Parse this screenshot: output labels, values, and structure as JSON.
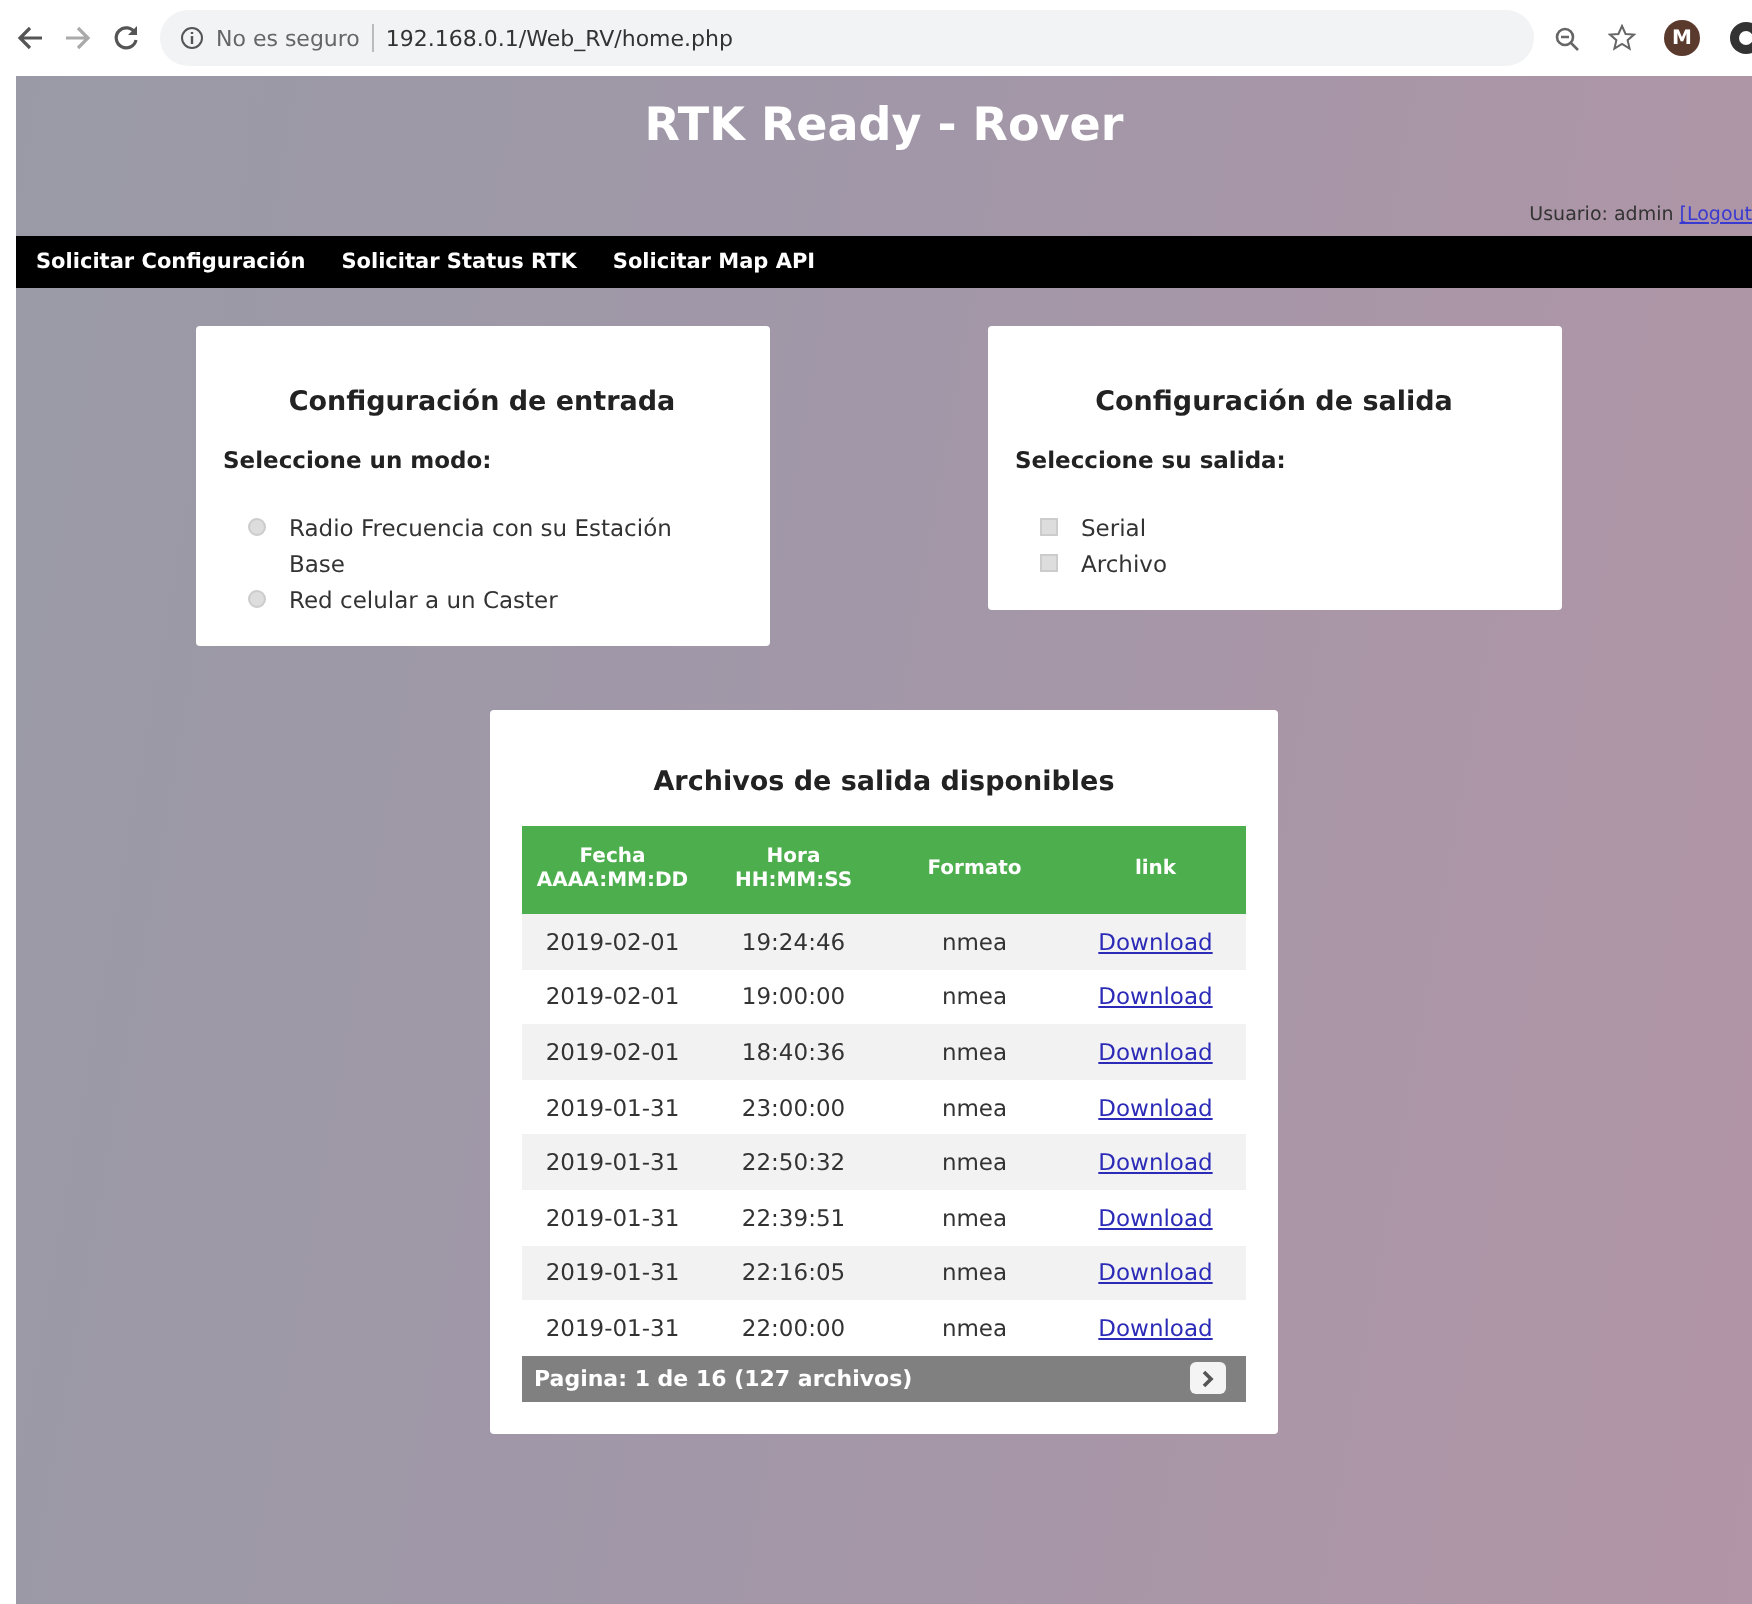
{
  "browser": {
    "security": "No es seguro",
    "url": "192.168.0.1/Web_RV/home.php",
    "avatar": "M"
  },
  "header": {
    "title": "RTK Ready - Rover",
    "user_label": "Usuario: admin",
    "logout": "[Logout"
  },
  "nav": [
    "Solicitar Configuración",
    "Solicitar Status RTK",
    "Solicitar Map API"
  ],
  "input_card": {
    "title": "Configuración de entrada",
    "prompt": "Seleccione un modo:",
    "kind": "radio",
    "options": [
      {
        "label": "Radio Frecuencia con su Estación Base",
        "selected": false
      },
      {
        "label": "Red celular a un Caster",
        "selected": false
      }
    ]
  },
  "output_card": {
    "title": "Configuración de salida",
    "prompt": "Seleccione su salida:",
    "kind": "checkbox",
    "options": [
      {
        "label": "Serial",
        "checked": false
      },
      {
        "label": "Archivo",
        "checked": false
      }
    ]
  },
  "files": {
    "title": "Archivos de salida disponibles",
    "columns": [
      "Fecha AAAA:MM:DD",
      "Hora HH:MM:SS",
      "Formato",
      "link"
    ],
    "rows": [
      [
        "2019-02-01",
        "19:24:46",
        "nmea",
        "Download"
      ],
      [
        "2019-02-01",
        "19:00:00",
        "nmea",
        "Download"
      ],
      [
        "2019-02-01",
        "18:40:36",
        "nmea",
        "Download"
      ],
      [
        "2019-01-31",
        "23:00:00",
        "nmea",
        "Download"
      ],
      [
        "2019-01-31",
        "22:50:32",
        "nmea",
        "Download"
      ],
      [
        "2019-01-31",
        "22:39:51",
        "nmea",
        "Download"
      ],
      [
        "2019-01-31",
        "22:16:05",
        "nmea",
        "Download"
      ],
      [
        "2019-01-31",
        "22:00:00",
        "nmea",
        "Download"
      ]
    ],
    "pagination": "Pagina: 1 de 16 (127 archivos)"
  }
}
